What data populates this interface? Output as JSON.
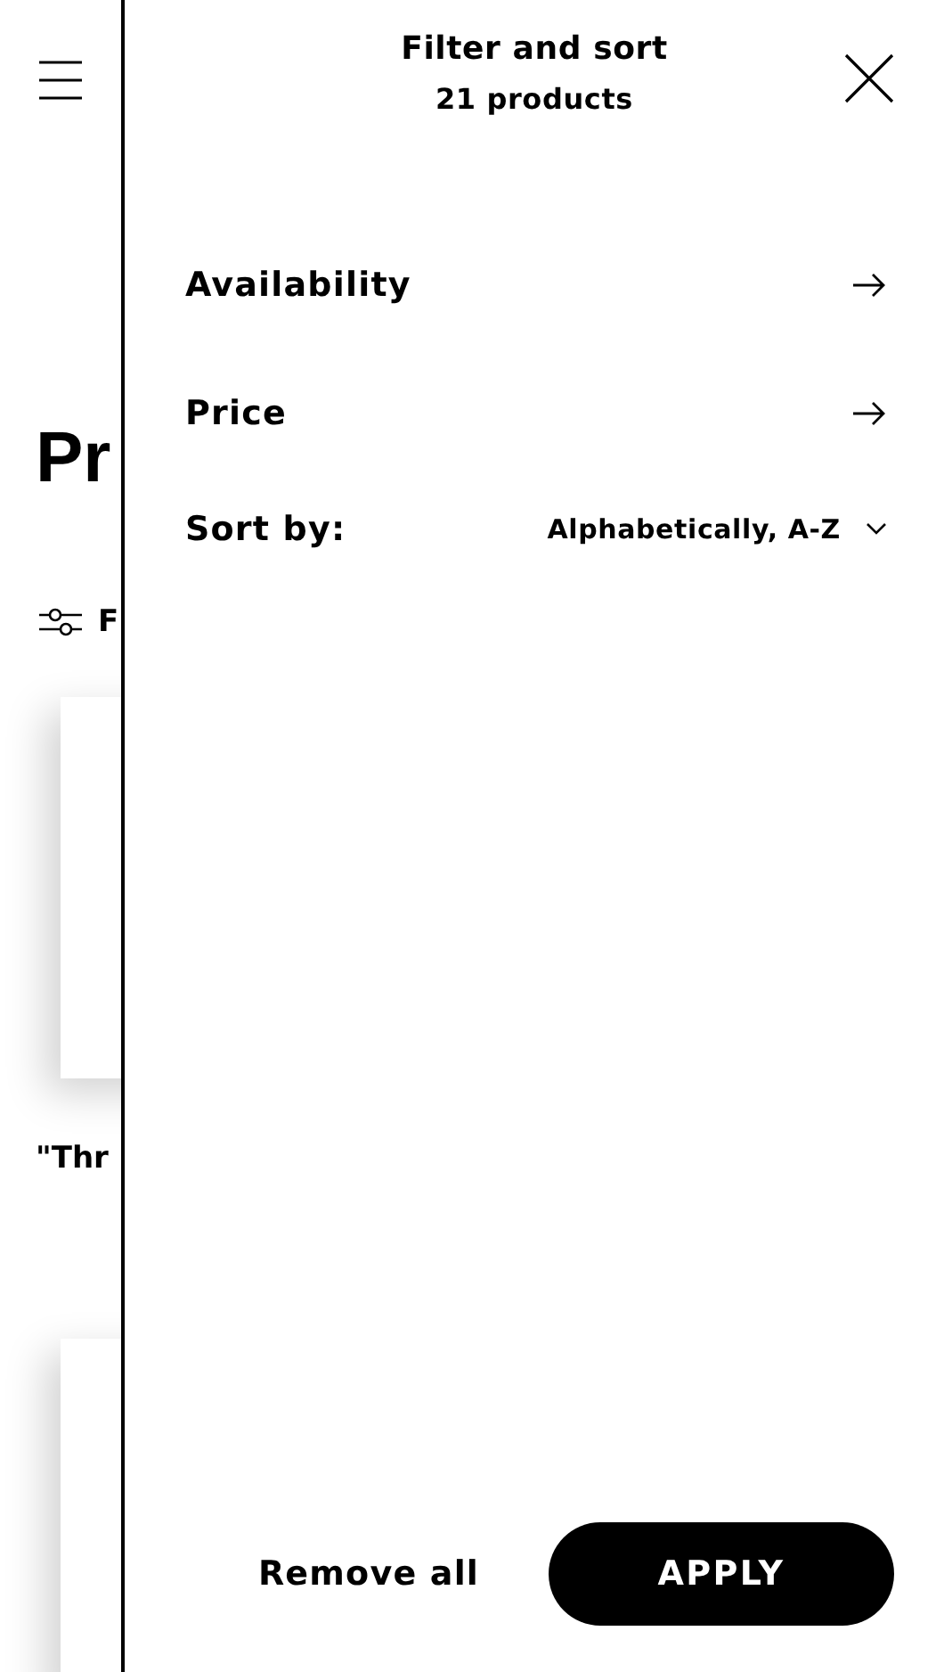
{
  "page": {
    "heading": "Pr",
    "filter_label": "F",
    "product_title": "\"Thr"
  },
  "drawer": {
    "title": "Filter and sort",
    "subtitle": "21 products",
    "filters": [
      {
        "label": "Availability"
      },
      {
        "label": "Price"
      }
    ],
    "sort": {
      "label": "Sort by:",
      "value": "Alphabetically, A-Z"
    },
    "remove_all": "Remove all",
    "apply": "APPLY"
  }
}
